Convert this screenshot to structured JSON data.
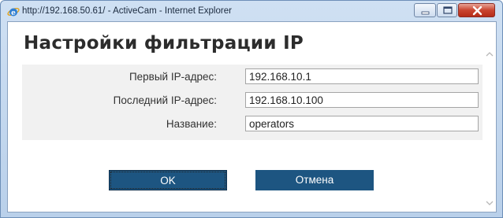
{
  "window": {
    "title": "http://192.168.50.61/ - ActiveCam - Internet Explorer",
    "icon": "internet-explorer-icon",
    "controls": [
      "minimize-icon",
      "maximize-icon",
      "close-icon"
    ]
  },
  "dialog": {
    "heading": "Настройки фильтрации IP",
    "fields": [
      {
        "label": "Первый IP-адрес:",
        "value": "192.168.10.1"
      },
      {
        "label": "Последний IP-адрес:",
        "value": "192.168.10.100"
      },
      {
        "label": "Название:",
        "value": "operators"
      }
    ],
    "buttons": {
      "ok": "OK",
      "cancel": "Отмена"
    }
  },
  "colors": {
    "button": "#1d5581",
    "panel": "#f1f1f1",
    "close": "#c9442f"
  }
}
